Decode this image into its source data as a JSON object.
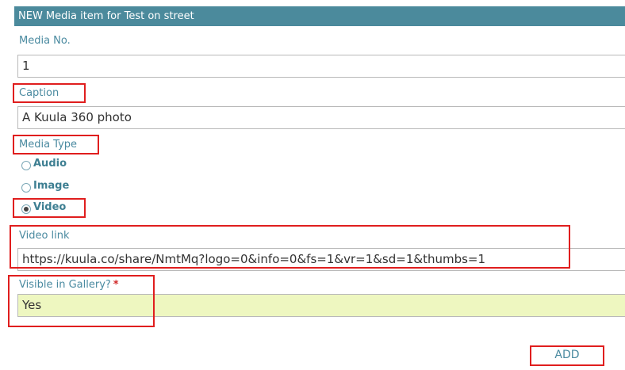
{
  "form": {
    "title": "NEW Media item for Test on street",
    "media_no": {
      "label": "Media No.",
      "value": "1"
    },
    "caption": {
      "label": "Caption",
      "value": "A Kuula 360 photo"
    },
    "media_type": {
      "label": "Media Type",
      "options": [
        {
          "label": "Audio",
          "selected": false
        },
        {
          "label": "Image",
          "selected": false
        },
        {
          "label": "Video",
          "selected": true
        }
      ]
    },
    "video_link": {
      "label": "Video link",
      "value": "https://kuula.co/share/NmtMq?logo=0&info=0&fs=1&vr=1&sd=1&thumbs=1"
    },
    "visible_in_gallery": {
      "label": "Visible in Gallery?",
      "required_mark": "*",
      "value": "Yes"
    },
    "add_label": "ADD"
  },
  "colors": {
    "header_bg": "#4b8a9c",
    "label": "#4a8aa0",
    "annotation": "#e01e1e",
    "highlight_field": "#eef7c0"
  }
}
